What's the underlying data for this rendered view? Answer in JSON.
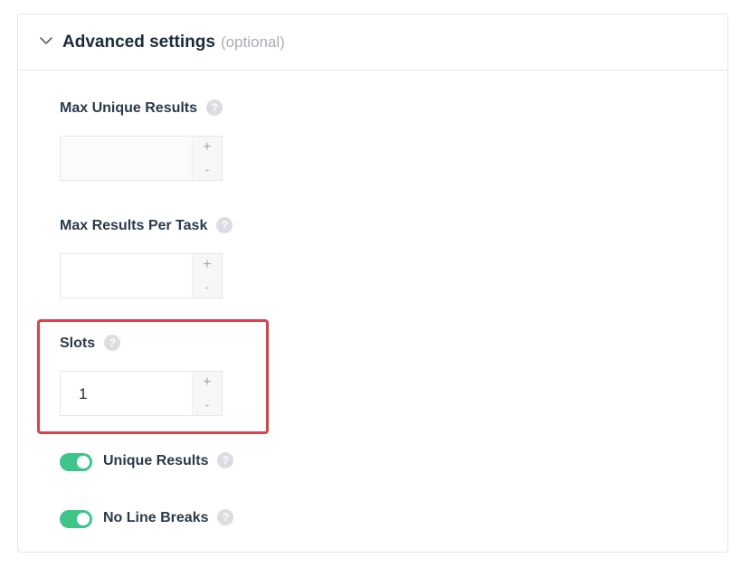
{
  "section": {
    "title": "Advanced settings",
    "optional_label": "(optional)",
    "expanded": true
  },
  "fields": {
    "max_unique_results": {
      "label": "Max Unique Results",
      "value": "",
      "help_icon": "question-circle-icon"
    },
    "max_results_per_task": {
      "label": "Max Results Per Task",
      "value": "",
      "help_icon": "question-circle-icon"
    },
    "slots": {
      "label": "Slots",
      "value": "1",
      "help_icon": "question-circle-icon"
    }
  },
  "stepper": {
    "increment": "+",
    "decrement": "-"
  },
  "help_glyph": "?",
  "toggles": {
    "unique_results": {
      "label": "Unique Results",
      "on": true
    },
    "no_line_breaks": {
      "label": "No Line Breaks",
      "on": true
    }
  },
  "colors": {
    "toggle_on": "#3fc58a",
    "highlight": "#d9434b",
    "help_bg": "#dcdde3"
  }
}
